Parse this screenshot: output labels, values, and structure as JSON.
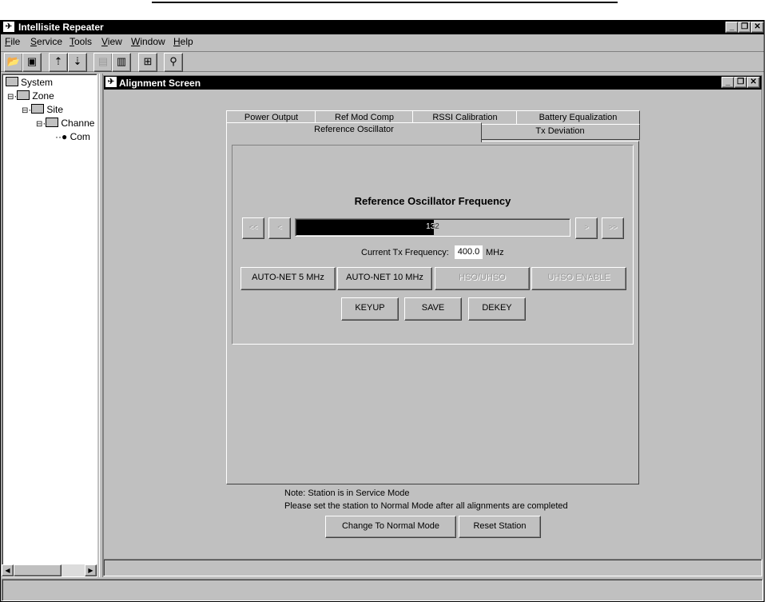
{
  "app": {
    "title": "Intellisite Repeater",
    "icon": "app-logo-icon"
  },
  "menu": [
    {
      "label": "File",
      "mnemonic": "F",
      "rest": "ile"
    },
    {
      "label": "Service",
      "mnemonic": "S",
      "rest": "ervice"
    },
    {
      "label": "Tools",
      "mnemonic": "T",
      "rest": "ools"
    },
    {
      "label": "View",
      "mnemonic": "V",
      "rest": "iew"
    },
    {
      "label": "Window",
      "mnemonic": "W",
      "rest": "indow"
    },
    {
      "label": "Help",
      "mnemonic": "H",
      "rest": "elp"
    }
  ],
  "window_controls": {
    "minimize": "_",
    "restore": "❐",
    "close": "✕"
  },
  "tree": {
    "items": [
      {
        "label": "System"
      },
      {
        "label": "Zone",
        "expander": "⊟"
      },
      {
        "label": "Site",
        "expander": "⊟"
      },
      {
        "label": "Channe",
        "expander": "⊟"
      },
      {
        "label": "Com"
      }
    ]
  },
  "alignment": {
    "title": "Alignment Screen",
    "tabs_back": [
      "Power Output",
      "Ref Mod Comp",
      "RSSI Calibration",
      "Battery Equalization"
    ],
    "tabs_front": [
      "Reference Oscillator",
      "Tx Deviation"
    ],
    "section_title": "Reference Oscillator Frequency",
    "slider": {
      "value_label": "132",
      "fill_fraction": 0.5
    },
    "nav": {
      "first": "<<",
      "prev": "<",
      "next": ">",
      "last": ">>"
    },
    "freq_label": "Current Tx Frequency:",
    "freq_value": "400.0",
    "freq_unit": "MHz",
    "buttons_row1": [
      "AUTO-NET 5 MHz",
      "AUTO-NET 10 MHz",
      "HSO/UHSO",
      "UHSO ENABLE"
    ],
    "buttons_row2": [
      "KEYUP",
      "SAVE",
      "DEKEY"
    ],
    "note_line1": "Note: Station is in Service Mode",
    "note_line2": "Please set the station to Normal Mode after all alignments are completed",
    "btn_normal_mode": "Change To Normal Mode",
    "btn_reset": "Reset Station"
  }
}
